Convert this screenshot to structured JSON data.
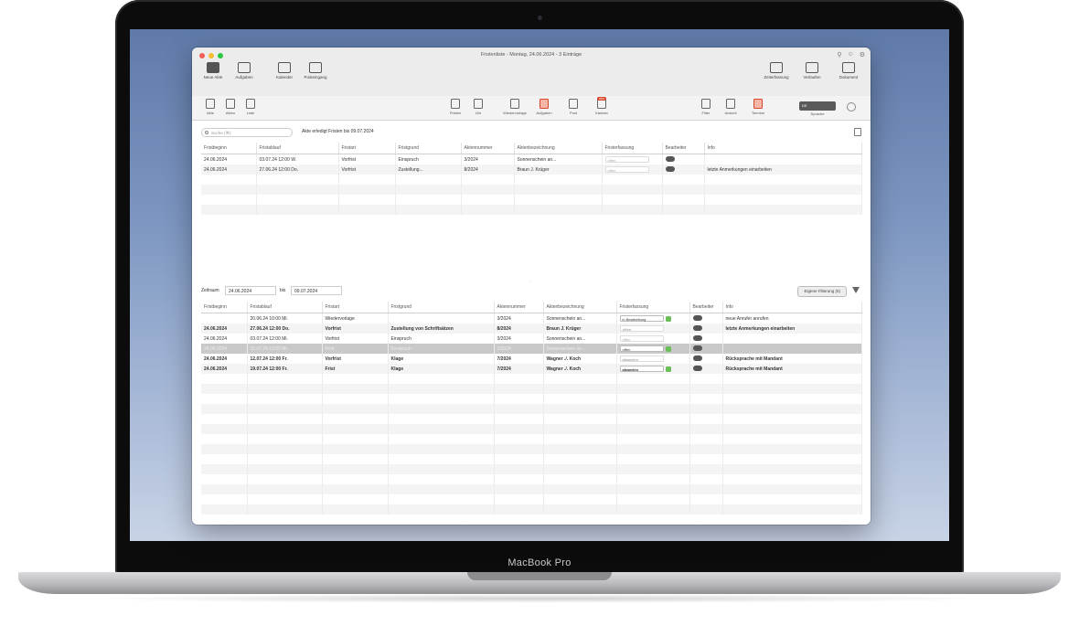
{
  "device": {
    "label": "MacBook Pro"
  },
  "window": {
    "title": "Fristenliste - Montag, 24.06.2024 - 3 Einträge",
    "traffic_lights": [
      "#f25f57",
      "#f8bd2e",
      "#2ac840"
    ],
    "toolbar": [
      {
        "label": "Neue Akte",
        "icon": "new-file-icon"
      },
      {
        "label": "Aufgaben",
        "icon": "cube-icon"
      },
      {
        "label": "Kalender",
        "icon": "calendar-icon"
      },
      {
        "label": "Posteingang",
        "icon": "inbox-icon"
      }
    ],
    "toolbar_right": [
      {
        "label": "Zeiterfassung",
        "icon": "timer-icon"
      },
      {
        "label": "Verlaufen",
        "icon": "house-icon"
      },
      {
        "label": "Dokument",
        "icon": "document-icon"
      }
    ],
    "toolbar2_left": [
      {
        "label": "Akte",
        "icon": "folder-icon"
      },
      {
        "label": "Akten",
        "icon": "folder-icon"
      },
      {
        "label": "Liste",
        "icon": "list-icon"
      }
    ],
    "toolbar2_mid": [
      {
        "label": "Fristen",
        "icon": "calendar-small-icon"
      },
      {
        "label": "Uhr",
        "icon": "clock-icon"
      },
      {
        "label": "Wiedervorlage",
        "icon": "note-icon"
      },
      {
        "label": "Aufgaben",
        "icon": "task-icon"
      },
      {
        "label": "Post",
        "icon": "book-icon"
      },
      {
        "label": "Kanban",
        "icon": "board-icon",
        "badge": "neu"
      }
    ],
    "toolbar2_right": [
      {
        "label": "Filter",
        "icon": "filter-doc-icon"
      },
      {
        "label": "Ansicht",
        "icon": "view-icon"
      },
      {
        "label": "Termine",
        "icon": "calendar-red-icon"
      }
    ],
    "segment": {
      "value": "DE",
      "label": "Sprache"
    }
  },
  "upper": {
    "search_placeholder": "Suche (⌘)",
    "filter_text": "Akte erledigt Fristen bis 09.07.2024",
    "columns": [
      "Fristbeginn",
      "Fristablauf",
      "Fristart",
      "Fristgrund",
      "Aktennummer",
      "Aktenbezeichnung",
      "Fristerfassung",
      "Bearbeiter",
      "Info"
    ],
    "rows": [
      [
        "24.06.2024",
        "03.07.24 12:00 W.",
        "Vorfrist",
        "Einspruch",
        "3/2024",
        "Sonnenschein an...",
        "offen",
        "",
        ""
      ],
      [
        "24.06.2024",
        "27.06.24 12:00 Do.",
        "Vorfrist",
        "Zustellung...",
        "8/2024",
        "Braun J. Krüger",
        "offen",
        "",
        "letzte Anmerkungen einarbeiten"
      ]
    ]
  },
  "lower": {
    "period_label": "Zeitraum",
    "date_from": "24.06.2024",
    "to_label": "bis",
    "date_to": "09.07.2024",
    "filter_button": "Eigene Filterung (5)",
    "columns": [
      "Fristbeginn",
      "Fristablauf",
      "Fristart",
      "Fristgrund",
      "Aktennummer",
      "Aktenbezeichnung",
      "Fristerfassung",
      "Bearbeiter",
      "Info"
    ],
    "rows": [
      {
        "cells": [
          "",
          "20.06.24 10:00 Mi.",
          "Wiedervorlage",
          "",
          "3/2024",
          "Sonnenschein an...",
          "in Bearbeitung",
          "",
          "neue Anrufer anrufen"
        ],
        "check": true,
        "style": ""
      },
      {
        "cells": [
          "24.06.2024",
          "27.06.24 12:00 Do.",
          "Vorfrist",
          "Zustellung von Schriftsätzen",
          "8/2024",
          "Braun J. Krüger",
          "offen",
          "",
          "letzte Anmerkungen einarbeiten"
        ],
        "check": false,
        "style": "bold"
      },
      {
        "cells": [
          "24.06.2024",
          "03.07.24 12:00 Mi.",
          "Vorfrist",
          "Einspruch",
          "3/2024",
          "Sonnenschein an...",
          "offen",
          "",
          ""
        ],
        "check": false,
        "style": ""
      },
      {
        "cells": [
          "24.06.2024",
          "10.07.24 12:00 Mi.",
          "Frist",
          "Einspruch",
          "3/2024",
          "Sonnenschein an...",
          "offen",
          "",
          ""
        ],
        "check": true,
        "style": "sel"
      },
      {
        "cells": [
          "24.06.2024",
          "12.07.24 12:00 Fr.",
          "Vorfrist",
          "Klage",
          "7/2024",
          "Wagner ./. Koch",
          "abwarten",
          "",
          "Rücksprache mit Mandant"
        ],
        "check": false,
        "style": "bold"
      },
      {
        "cells": [
          "24.06.2024",
          "19.07.24 12:00 Fr.",
          "Frist",
          "Klage",
          "7/2024",
          "Wagner ./. Koch",
          "abwarten",
          "",
          "Rücksprache mit Mandant"
        ],
        "check": true,
        "style": "bold"
      }
    ]
  }
}
